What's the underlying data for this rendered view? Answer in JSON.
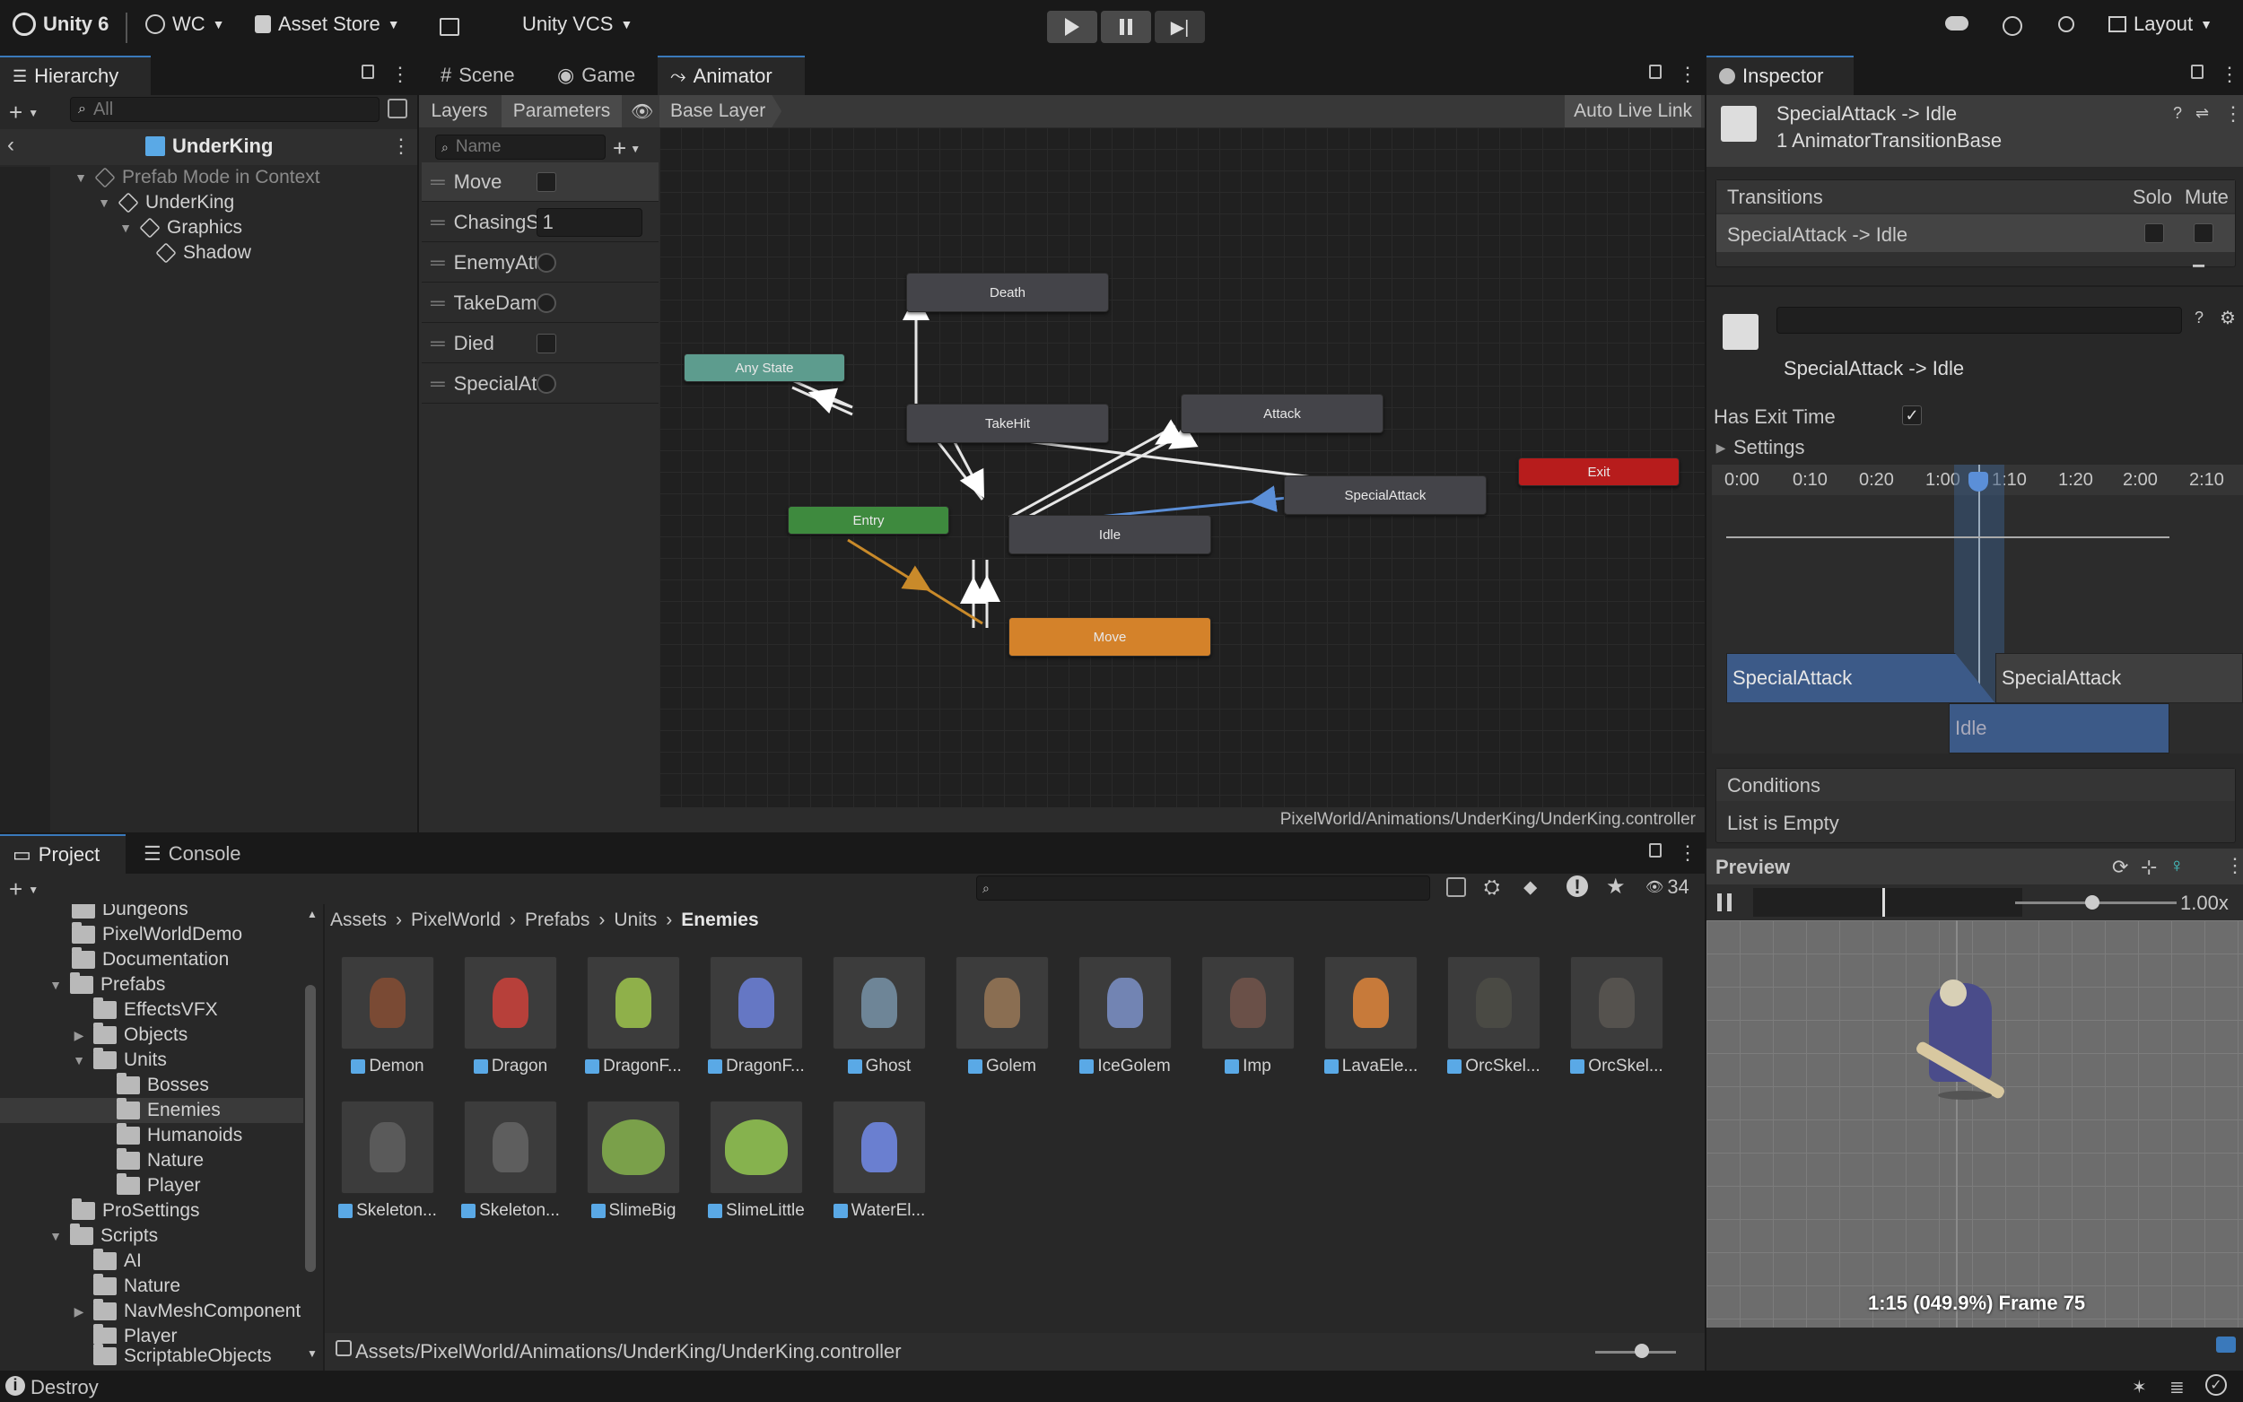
{
  "toolbar": {
    "app": "Unity 6",
    "account": "WC",
    "asset_store": "Asset Store",
    "vcs": "Unity VCS",
    "layout": "Layout"
  },
  "hierarchy": {
    "tab": "Hierarchy",
    "search_placeholder": "All",
    "root": "UnderKing",
    "items": [
      "Prefab Mode in Context",
      "UnderKing",
      "Graphics",
      "Shadow"
    ]
  },
  "center_tabs": {
    "scene": "Scene",
    "game": "Game",
    "animator": "Animator"
  },
  "animator": {
    "layers_tab": "Layers",
    "parameters_tab": "Parameters",
    "search_placeholder": "Name",
    "breadcrumb": "Base Layer",
    "auto_live_link": "Auto Live Link",
    "path": "PixelWorld/Animations/UnderKing/UnderKing.controller",
    "params": [
      {
        "name": "Move",
        "type": "bool"
      },
      {
        "name": "ChasingS",
        "type": "float",
        "value": "1"
      },
      {
        "name": "EnemyAtt",
        "type": "trigger"
      },
      {
        "name": "TakeDam",
        "type": "trigger"
      },
      {
        "name": "Died",
        "type": "bool"
      },
      {
        "name": "SpecialAtt",
        "type": "trigger"
      }
    ],
    "states": {
      "death": "Death",
      "any_state": "Any State",
      "take_hit": "TakeHit",
      "attack": "Attack",
      "special_attack": "SpecialAttack",
      "exit": "Exit",
      "entry": "Entry",
      "idle": "Idle",
      "move": "Move"
    },
    "colors": {
      "any": "#5d9c8e",
      "entry": "#3e8a3e",
      "exit": "#b71c1c",
      "default": "#d4822a",
      "node": "#444449"
    }
  },
  "inspector": {
    "tab": "Inspector",
    "title": "SpecialAttack -> Idle",
    "subtitle": "1 AnimatorTransitionBase",
    "transitions_label": "Transitions",
    "solo": "Solo",
    "mute": "Mute",
    "transition_row": "SpecialAttack -> Idle",
    "transition_name": "SpecialAttack -> Idle",
    "has_exit_time": "Has Exit Time",
    "settings": "Settings",
    "timeline_ticks": [
      "0:00",
      "0:10",
      "0:20",
      "1:00",
      "1:10",
      "1:20",
      "2:00",
      "2:10"
    ],
    "clip_from": "SpecialAttack",
    "clip_from_next": "SpecialAttack",
    "clip_to": "Idle",
    "conditions": "Conditions",
    "list_empty": "List is Empty"
  },
  "preview": {
    "label": "Preview",
    "speed": "1.00x",
    "frame": "1:15 (049.9%) Frame 75"
  },
  "project": {
    "tab_project": "Project",
    "tab_console": "Console",
    "count": "34",
    "breadcrumb": [
      "Assets",
      "PixelWorld",
      "Prefabs",
      "Units",
      "Enemies"
    ],
    "tree": [
      "Dungeons",
      "PixelWorldDemo",
      "Documentation",
      "Prefabs",
      "EffectsVFX",
      "Objects",
      "Units",
      "Bosses",
      "Enemies",
      "Humanoids",
      "Nature",
      "Player",
      "ProSettings",
      "Scripts",
      "AI",
      "Nature",
      "NavMeshComponent",
      "Player",
      "ScriptableObjects"
    ],
    "assets": [
      "Demon",
      "Dragon",
      "DragonF...",
      "DragonF...",
      "Ghost",
      "Golem",
      "IceGolem",
      "Imp",
      "LavaEle...",
      "OrcSkel...",
      "OrcSkel...",
      "Skeleton...",
      "Skeleton...",
      "SlimeBig",
      "SlimeLittle",
      "WaterEl..."
    ],
    "asset_colors": [
      "#7a4a34",
      "#b7403a",
      "#8fb04a",
      "#6577c4",
      "#6e8597",
      "#8a6e52",
      "#7284b3",
      "#6a5048",
      "#c77a3a",
      "#4a4a44",
      "#55524e",
      "#5a5a5a",
      "#5e5e5e",
      "#7aa04a",
      "#86b24e",
      "#6a7fd0"
    ],
    "path": "Assets/PixelWorld/Animations/UnderKing/UnderKing.controller"
  },
  "status": {
    "text": "Destroy"
  }
}
